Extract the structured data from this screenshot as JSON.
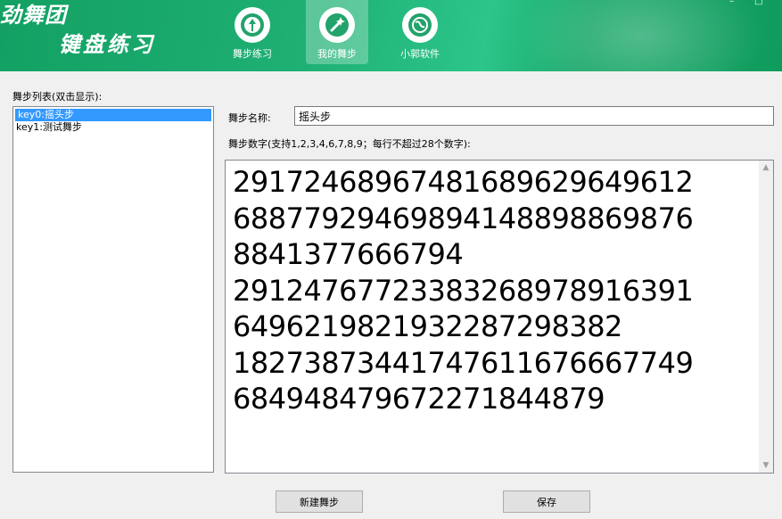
{
  "header": {
    "logo_line1": "劲舞团",
    "logo_line2": "键盘练习",
    "tabs": [
      {
        "label": "舞步练习",
        "icon": "dance-practice-icon"
      },
      {
        "label": "我的舞步",
        "icon": "magic-wand-icon"
      },
      {
        "label": "小郭软件",
        "icon": "globe-icon"
      }
    ],
    "active_tab": "我的舞步",
    "window_controls": {
      "minimize": "–",
      "maximize": "□"
    }
  },
  "list": {
    "title": "舞步列表(双击显示):",
    "items": [
      {
        "label": "key0:摇头步",
        "selected": true
      },
      {
        "label": "key1:测试舞步",
        "selected": false
      }
    ]
  },
  "form": {
    "name_label": "舞步名称:",
    "name_value": "摇头步",
    "digits_label": "舞步数字(支持1,2,3,4,6,7,8,9；每行不超过28个数字):",
    "digits_lines": [
      "291724689674816896296 49612",
      "688779294698941488988 69876",
      "8841377666794",
      "291247677233832689789 16391",
      "649621982193228729838 2",
      "182738734417476116766 67749",
      "684948479672271844879"
    ]
  },
  "buttons": {
    "new": "新建舞步",
    "save": "保存"
  },
  "colors": {
    "header_green": "#1aa86a",
    "selection_blue": "#3399ff"
  }
}
